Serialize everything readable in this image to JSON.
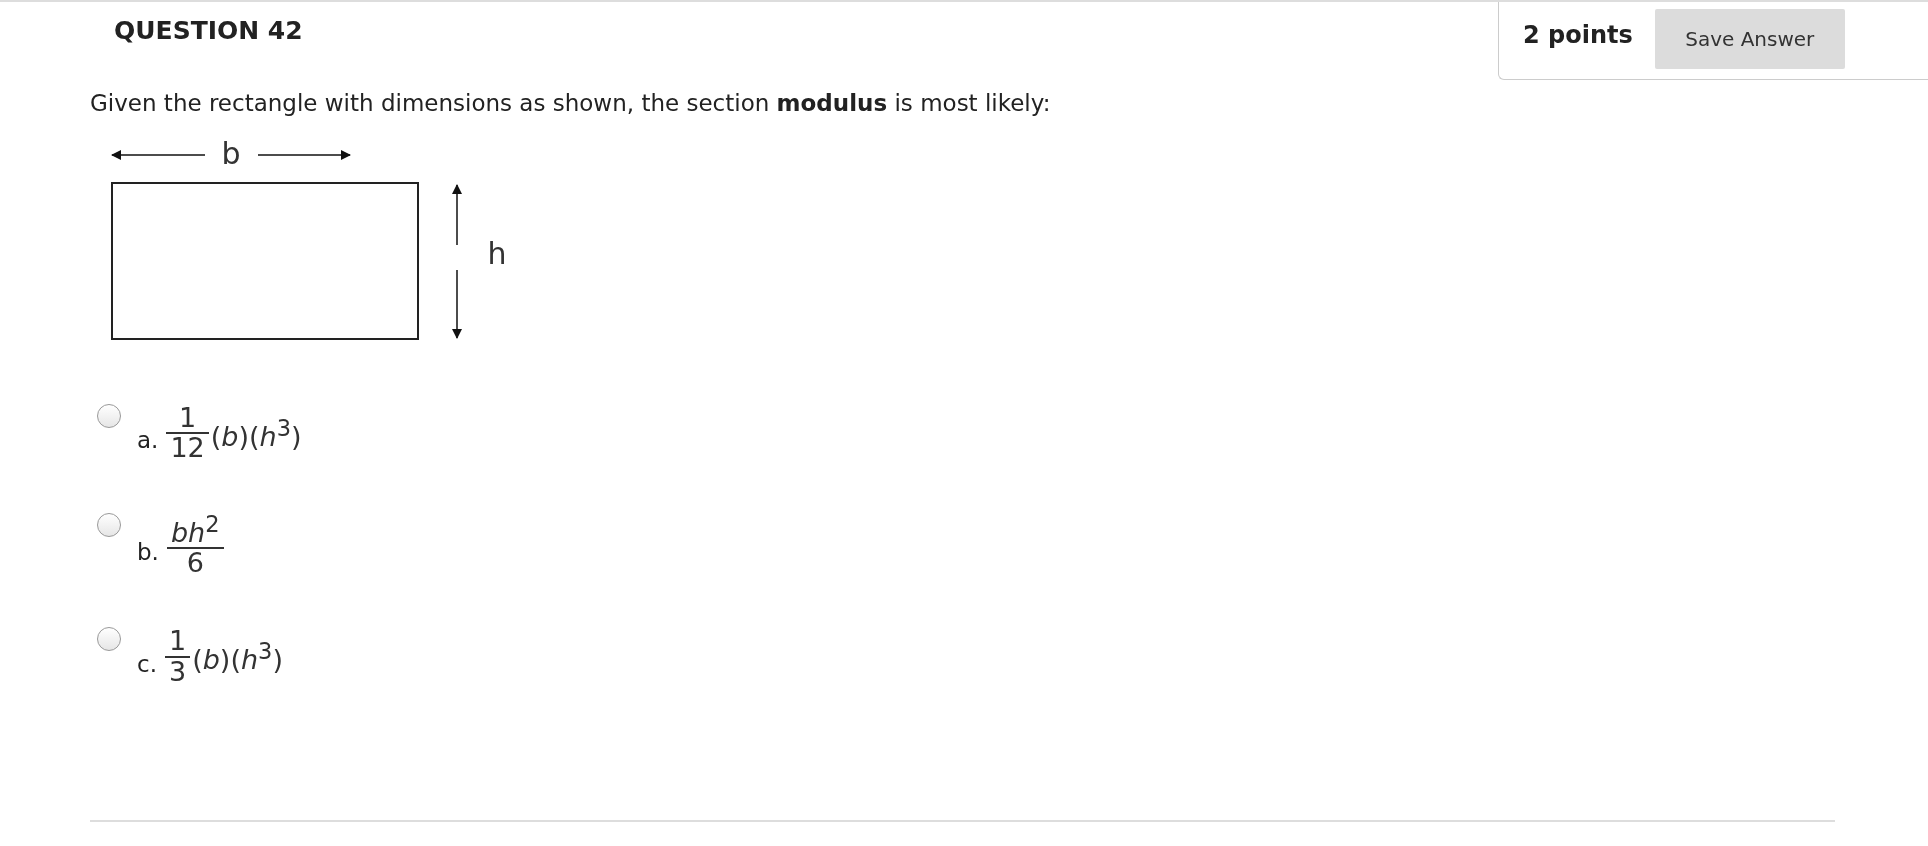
{
  "question": {
    "title": "QUESTION 42",
    "points": "2 points",
    "save_button": "Save Answer",
    "prompt": "Given the rectangle with dimensions as shown, the section **modulus** is most likely:"
  },
  "diagram": {
    "width_label": "b",
    "height_label": "h"
  },
  "options": [
    {
      "letter": "a.",
      "numerator": "1",
      "denominator": "12",
      "suffix": "(*b*)(*h*$^{3}$)",
      "selected": false
    },
    {
      "letter": "b.",
      "numerator": "*bh*$^{2}$",
      "denominator": "6",
      "selected": false
    },
    {
      "letter": "c.",
      "numerator": "1",
      "denominator": "3",
      "suffix": "(*b*)(*h*$^{3}$)",
      "selected": false
    }
  ]
}
